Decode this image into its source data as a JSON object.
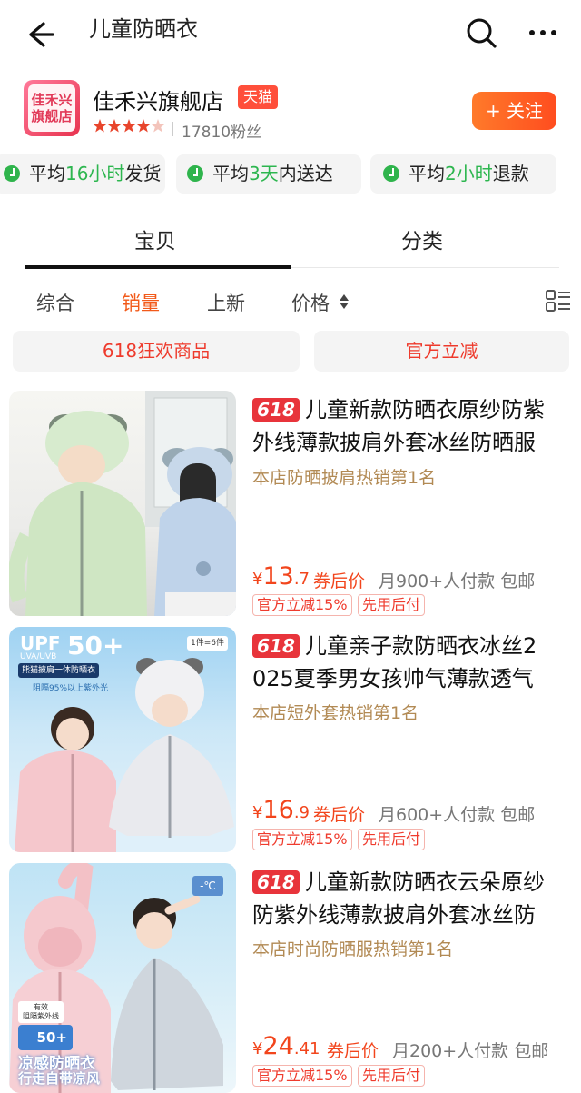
{
  "search": {
    "query": "儿童防晒衣"
  },
  "store": {
    "logo_text": [
      "佳禾兴",
      "旗舰店"
    ],
    "name": "佳禾兴旗舰店",
    "badge": "天猫",
    "rating_stars": 4.5,
    "fans": "17810粉丝",
    "follow_label": "+ 关注"
  },
  "services": [
    {
      "pre": "平均",
      "num": "16小时",
      "post": "发货"
    },
    {
      "pre": "平均",
      "num": "3天",
      "post": "内送达"
    },
    {
      "pre": "平均",
      "num": "2小时",
      "post": "退款"
    }
  ],
  "tabs": [
    "宝贝",
    "分类"
  ],
  "sort": [
    "综合",
    "销量",
    "上新",
    "价格"
  ],
  "promo_filters": [
    "618狂欢商品",
    "官方立减"
  ],
  "colors": {
    "accent": "#f2451c",
    "tmall": "#ff4f3b",
    "green": "#2db64f",
    "rank": "#b28a54"
  },
  "products": [
    {
      "badge": "618",
      "title_line1": "儿童新款防晒衣原纱防紫",
      "title_line2": "外线薄款披肩外套冰丝防晒服",
      "rank": "本店防晒披肩热销第1名",
      "price_int": "13",
      "price_dec": ".7",
      "after_coupon": "券后价",
      "sold": "月900+人付款 包邮",
      "tags": [
        "官方立减15%",
        "先用后付"
      ]
    },
    {
      "badge": "618",
      "title_line1": "儿童亲子款防晒衣冰丝2",
      "title_line2": "025夏季男女孩帅气薄款透气",
      "rank": "本店短外套热销第1名",
      "price_int": "16",
      "price_dec": ".9",
      "after_coupon": "券后价",
      "sold": "月600+人付款 包邮",
      "tags": [
        "官方立减15%",
        "先用后付"
      ],
      "image_text": {
        "upf": "UPF",
        "upf_val": "50+",
        "uva": "UVA/UVB",
        "label": "熊猫披肩一体防晒衣",
        "sub": "阻隔95%以上紫外光",
        "pack": "1件=6件"
      }
    },
    {
      "badge": "618",
      "title_line1": "儿童新款防晒衣云朵原纱",
      "title_line2": "防紫外线薄款披肩外套冰丝防",
      "rank": "本店时尚防晒服热销第1名",
      "price_int": "24",
      "price_dec": ".41",
      "after_coupon": "券后价",
      "sold": "月200+人付款 包邮",
      "tags": [
        "官方立减15%",
        "先用后付"
      ],
      "image_text": {
        "temp": "-℃",
        "eff1": "有效",
        "eff2": "阻隔紫外线",
        "upf": "50+",
        "slogan1": "凉感防晒衣",
        "slogan2": "行走自带凉风"
      }
    }
  ]
}
